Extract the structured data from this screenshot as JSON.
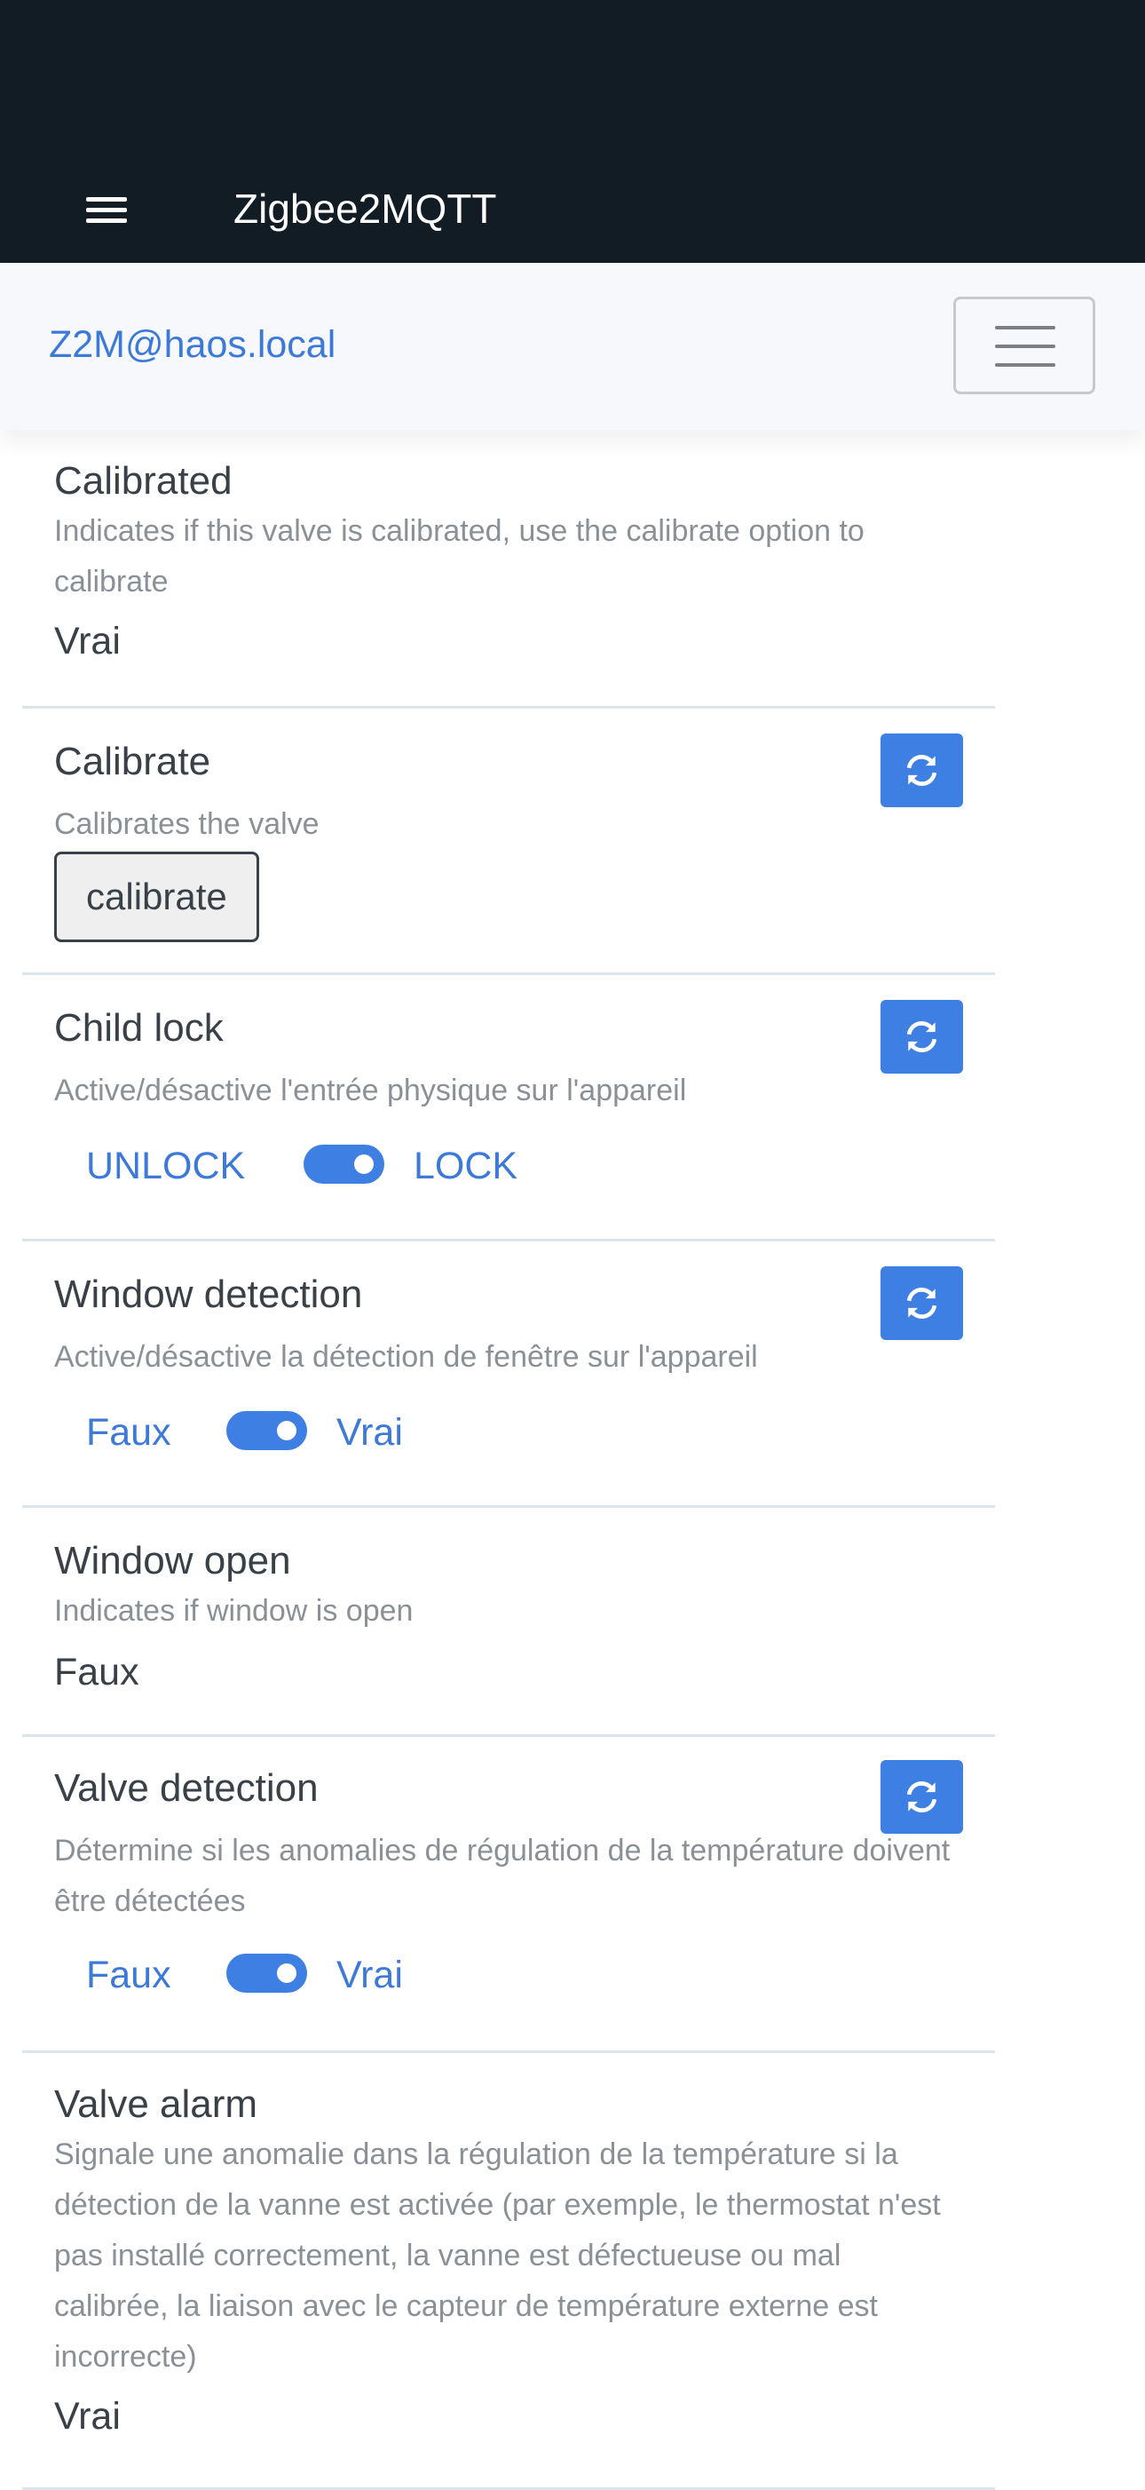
{
  "appbar": {
    "title": "Zigbee2MQTT"
  },
  "subnav": {
    "brand": "Z2M@haos.local"
  },
  "items": [
    {
      "title": "Calibrated",
      "description": "Indicates if this valve is calibrated, use the calibrate option to calibrate",
      "value": "Vrai"
    },
    {
      "title": "Calibrate",
      "description": "Calibrates the valve",
      "button_label": "calibrate"
    },
    {
      "title": "Child lock",
      "description": "Active/désactive l'entrée physique sur l'appareil",
      "off_label": "UNLOCK",
      "on_label": "LOCK",
      "state": "LOCK"
    },
    {
      "title": "Window detection",
      "description": "Active/désactive la détection de fenêtre sur l'appareil",
      "off_label": "Faux",
      "on_label": "Vrai",
      "state": "Vrai"
    },
    {
      "title": "Window open",
      "description": "Indicates if window is open",
      "value": "Faux"
    },
    {
      "title": "Valve detection",
      "description": "Détermine si les anomalies de régulation de la température doivent être détectées",
      "off_label": "Faux",
      "on_label": "Vrai",
      "state": "Vrai"
    },
    {
      "title": "Valve alarm",
      "description": "Signale une anomalie dans la régulation de la température si la détection de la vanne est activée (par exemple, le thermostat n'est pas installé correctement, la vanne est défectueuse ou mal calibrée, la liaison avec le capteur de température externe est incorrecte)",
      "value": "Vrai"
    }
  ],
  "colors": {
    "appbar": "#121c25",
    "accent": "#3e7fe3",
    "link": "#3c79d8"
  },
  "icons": {
    "menu": "hamburger-icon",
    "refresh": "refresh-icon",
    "toggler": "navbar-toggler-icon"
  }
}
